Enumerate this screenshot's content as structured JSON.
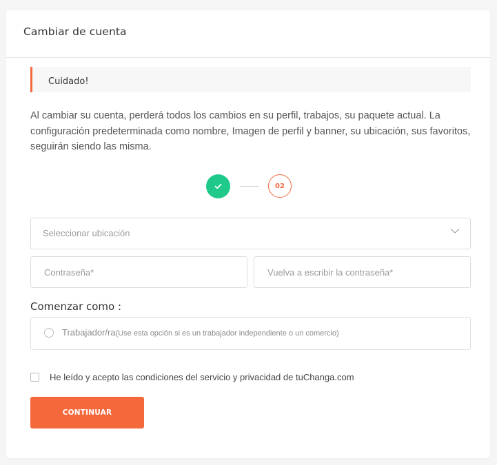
{
  "card": {
    "title": "Cambiar de cuenta"
  },
  "alert": {
    "title": "Cuidado!",
    "color": "#f4683c"
  },
  "warning": {
    "text": "Al cambiar su cuenta, perderá todos los cambios en su perfil, trabajos, su paquete actual. La configuración predeterminada como nombre, Imagen de perfil y banner, su ubicación, sus favoritos, seguirán siendo las misma."
  },
  "steps": {
    "step1_icon": "check-icon",
    "step1_color": "#1ec98a",
    "step2_label": "02",
    "step2_color": "#f4683c"
  },
  "form": {
    "location_placeholder": "Seleccionar ubicación",
    "password_placeholder": "Contraseña*",
    "password_confirm_placeholder": "Vuelva a escribir la contraseña*",
    "start_as_label": "Comenzar como :",
    "role_option_label": "Trabajador/ra",
    "role_option_note": "(Use esta opción si es un trabajador independiente o un comercio)",
    "terms_label": "He leído y acepto las condiciones del servicio y privacidad de tuChanga.com",
    "submit_label": "CONTINUAR",
    "accent": "#f4683c"
  }
}
